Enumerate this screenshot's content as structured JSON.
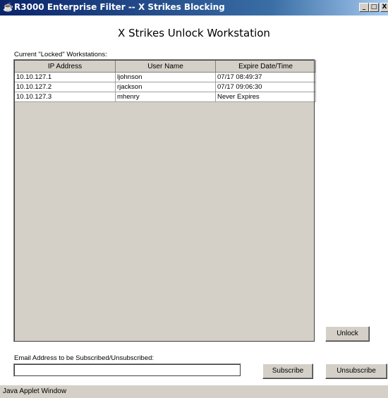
{
  "window": {
    "title": "R3000 Enterprise Filter -- X Strikes Blocking",
    "minimize": "_",
    "maximize": "□",
    "close": "X",
    "icon": "java-cup-icon"
  },
  "heading": "X Strikes Unlock Workstation",
  "locked_label": "Current \"Locked\" Workstations:",
  "table": {
    "columns": [
      "IP Address",
      "User Name",
      "Expire Date/Time"
    ],
    "rows": [
      [
        "10.10.127.1",
        "ljohnson",
        "07/17 08:49:37"
      ],
      [
        "10.10.127.2",
        "rjackson",
        "07/17 09:06:30"
      ],
      [
        "10.10.127.3",
        "mhenry",
        "Never Expires"
      ]
    ]
  },
  "buttons": {
    "unlock": "Unlock",
    "subscribe": "Subscribe",
    "unsubscribe": "Unsubscribe"
  },
  "email": {
    "label": "Email Address to be Subscribed/Unsubscribed:",
    "value": ""
  },
  "status": "Java Applet Window"
}
